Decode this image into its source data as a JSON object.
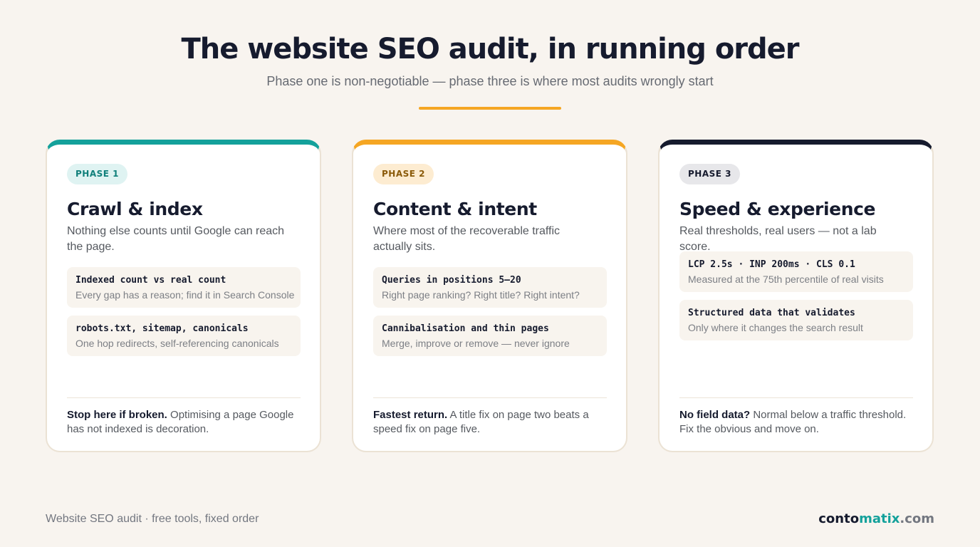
{
  "header": {
    "title": "The website SEO audit, in running order",
    "subtitle": "Phase one is non-negotiable — phase three is where most audits wrongly start"
  },
  "colors": {
    "background": "#f8f4ef",
    "teal": "#14a19b",
    "amber": "#f5a623",
    "navy": "#161b2e"
  },
  "phases": [
    {
      "badge": "PHASE 1",
      "title": "Crawl & index",
      "description": "Nothing else counts until Google can reach the page.",
      "items": [
        {
          "title": "Indexed count vs real count",
          "subtitle": "Every gap has a reason; find it in Search Console"
        },
        {
          "title": "robots.txt, sitemap, canonicals",
          "subtitle": "One hop redirects, self-referencing canonicals"
        }
      ],
      "note_bold": "Stop here if broken.",
      "note_text": "Optimising a page Google has not indexed is decoration."
    },
    {
      "badge": "PHASE 2",
      "title": "Content & intent",
      "description": "Where most of the recoverable traffic actually sits.",
      "items": [
        {
          "title": "Queries in positions 5–20",
          "subtitle": "Right page ranking? Right title? Right intent?"
        },
        {
          "title": "Cannibalisation and thin pages",
          "subtitle": "Merge, improve or remove — never ignore"
        }
      ],
      "note_bold": "Fastest return.",
      "note_text": "A title fix on page two beats a speed fix on page five."
    },
    {
      "badge": "PHASE 3",
      "title": "Speed & experience",
      "description": "Real thresholds, real users — not a lab score.",
      "items": [
        {
          "title": "LCP 2.5s · INP 200ms · CLS 0.1",
          "subtitle": "Measured at the 75th percentile of real visits"
        },
        {
          "title": "Structured data that validates",
          "subtitle": "Only where it changes the search result"
        }
      ],
      "note_bold": "No field data?",
      "note_text": "Normal below a traffic threshold. Fix the obvious and move on."
    }
  ],
  "footer": {
    "caption": "Website SEO audit · free tools, fixed order",
    "brand_part1": "conto",
    "brand_part2": "matix",
    "brand_part3": ".com"
  }
}
